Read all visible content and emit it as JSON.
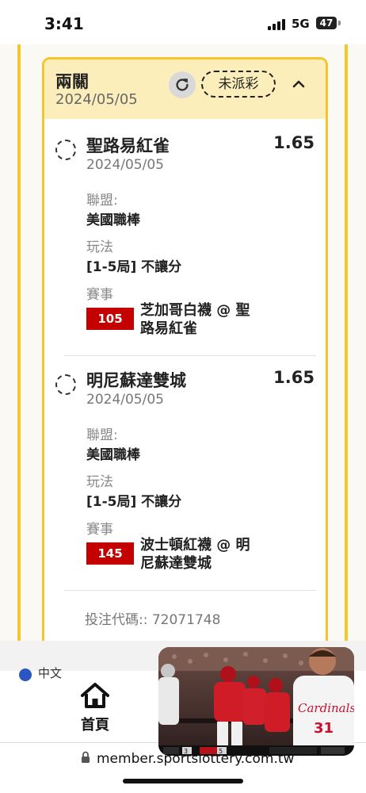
{
  "status_bar": {
    "time": "3:41",
    "network": "5G",
    "battery": "47"
  },
  "ticket": {
    "title": "兩關",
    "date": "2024/05/05",
    "status_pill": "未派彩",
    "bets": [
      {
        "team": "聖路易紅雀",
        "odds": "1.65",
        "date": "2024/05/05",
        "league_label": "聯盟:",
        "league": "美國職棒",
        "play_label": "玩法",
        "play": "[1-5局] 不讓分",
        "event_label": "賽事",
        "event_code": "105",
        "event_line1": "芝加哥白襪 @ 聖",
        "event_line2": "路易紅雀"
      },
      {
        "team": "明尼蘇達雙城",
        "odds": "1.65",
        "date": "2024/05/05",
        "league_label": "聯盟:",
        "league": "美國職棒",
        "play_label": "玩法",
        "play": "[1-5局] 不讓分",
        "event_label": "賽事",
        "event_code": "145",
        "event_line1": "波士頓紅襪 @ 明",
        "event_line2": "尼蘇達雙城"
      }
    ],
    "ticket_code_label": "投注代碼:: 72071748"
  },
  "nav": {
    "home_label": "首頁",
    "language": "中文"
  },
  "browser": {
    "url": "member.sportslottery.com.tw"
  },
  "video": {
    "jersey_text": "Cardinals",
    "jersey_number": "31",
    "score_a": "3",
    "score_b": "5"
  },
  "colors": {
    "accent_yellow": "#f4c62b",
    "header_bg": "#fbeebb",
    "event_red": "#c40000"
  }
}
